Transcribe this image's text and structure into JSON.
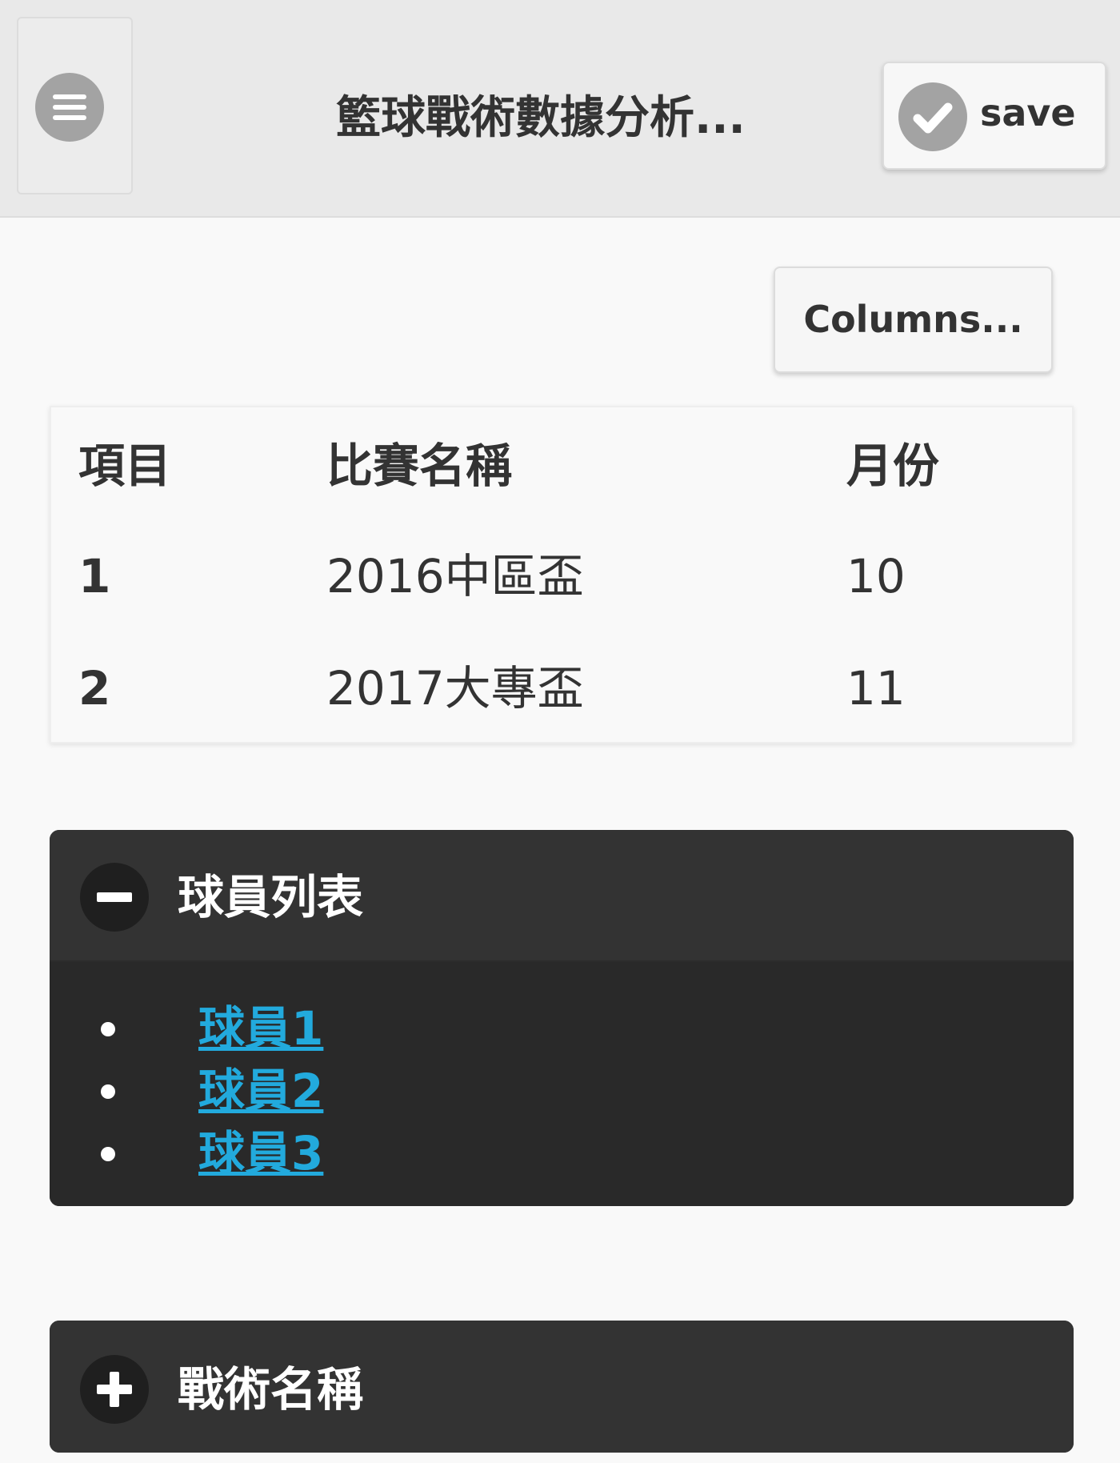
{
  "header": {
    "menu_icon": "hamburger-icon",
    "title": "籃球戰術數據分析...",
    "save_label": "save",
    "save_icon": "check-icon"
  },
  "toolbar": {
    "columns_label": "Columns..."
  },
  "table": {
    "headers": [
      "項目",
      "比賽名稱",
      "月份"
    ],
    "rows": [
      [
        "1",
        "2016中區盃",
        "10"
      ],
      [
        "2",
        "2017大專盃",
        "11"
      ]
    ]
  },
  "players_section": {
    "title": "球員列表",
    "state": "expanded",
    "icon": "minus-icon",
    "items": [
      "球員1",
      "球員2",
      "球員3"
    ]
  },
  "tactics_section": {
    "title": "戰術名稱",
    "state": "collapsed",
    "icon": "plus-icon"
  },
  "colors": {
    "header_bg": "#e9e9e9",
    "page_bg": "#f9f9f9",
    "panel_bg": "#2a2a2a",
    "link": "#22aadd",
    "icon_gray": "#a3a3a3"
  }
}
